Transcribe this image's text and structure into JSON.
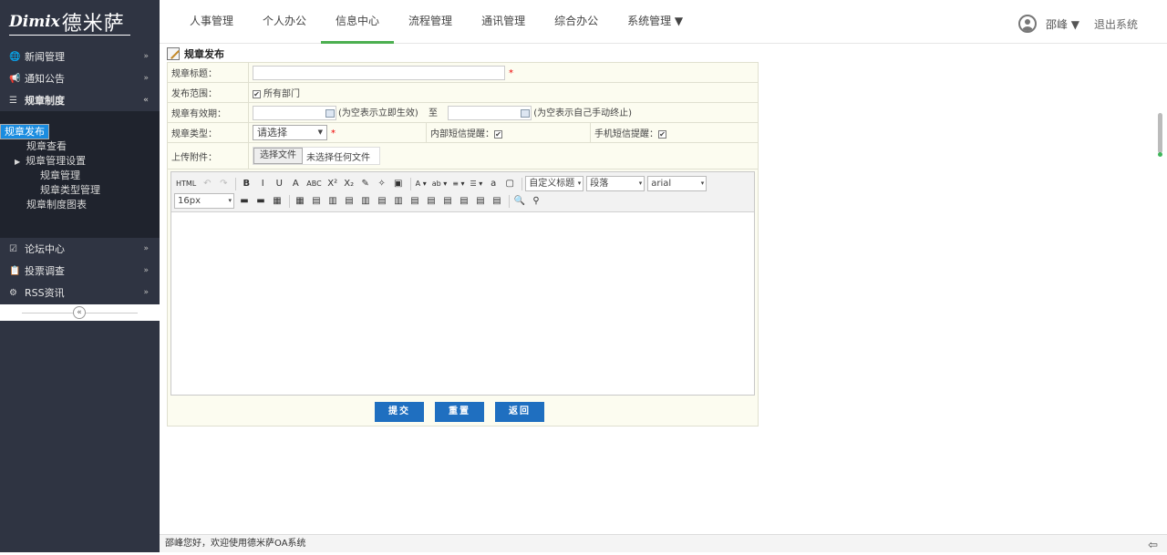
{
  "logo": {
    "en": "Dimix",
    "cn": "德米萨"
  },
  "sidebar": {
    "menus_top": [
      {
        "icon": "globe-icon",
        "glyph": "🌐",
        "label": "新闻管理",
        "arrow": "»"
      },
      {
        "icon": "megaphone-icon",
        "glyph": "📢",
        "label": "通知公告",
        "arrow": "»"
      },
      {
        "icon": "list-icon",
        "glyph": "☰",
        "label": "规章制度",
        "arrow": "«"
      }
    ],
    "sub_items": [
      {
        "label": "规章发布",
        "kind": "sel"
      },
      {
        "label": "规章查看",
        "kind": ""
      },
      {
        "label": "规章管理设置",
        "kind": "grp"
      },
      {
        "label": "规章管理",
        "kind": "l2"
      },
      {
        "label": "规章类型管理",
        "kind": "l2"
      },
      {
        "label": "规章制度图表",
        "kind": ""
      }
    ],
    "menus_bottom": [
      {
        "icon": "forum-icon",
        "glyph": "☑",
        "label": "论坛中心",
        "arrow": "»"
      },
      {
        "icon": "vote-icon",
        "glyph": "📋",
        "label": "投票调查",
        "arrow": "»"
      },
      {
        "icon": "rss-icon",
        "glyph": "⚙",
        "label": "RSS资讯",
        "arrow": "»"
      }
    ],
    "collapse_glyph": "«"
  },
  "topnav": {
    "items": [
      "人事管理",
      "个人办公",
      "信息中心",
      "流程管理",
      "通讯管理",
      "综合办公",
      "系统管理 ▼"
    ],
    "active_index": 2
  },
  "user": {
    "name": "邵峰 ▼",
    "logout": "退出系统"
  },
  "page": {
    "title": "规章发布"
  },
  "form": {
    "title_label": "规章标题：",
    "required_mark": "*",
    "scope_label": "发布范围：",
    "scope_check": "✔",
    "scope_option": "所有部门",
    "valid_label": "规章有效期：",
    "valid_hint1": "(为空表示立即生效)",
    "valid_to": "至",
    "valid_hint2": "(为空表示自己手动终止)",
    "type_label": "规章类型：",
    "type_value": "请选择",
    "type_arrow": "▼",
    "inner_sms_label": "内部短信提醒：",
    "inner_sms_check": "✔",
    "mobile_sms_label": "手机短信提醒：",
    "mobile_sms_check": "✔",
    "attach_label": "上传附件：",
    "attach_button": "选择文件",
    "attach_status": "未选择任何文件"
  },
  "editor": {
    "row1": [
      "HTML",
      "↶",
      "↷",
      "|",
      "B",
      "I",
      "U",
      "A",
      "ABC",
      "X²",
      "X₂",
      "✎",
      "✧",
      "▣",
      "|",
      "A ▾",
      "ab ▾",
      "≡ ▾",
      "☰ ▾",
      "a",
      "▢",
      "|"
    ],
    "heading_select": "自定义标题",
    "para_select": "段落",
    "font_select": "arial",
    "size_select": "16px",
    "row2": [
      "▬",
      "▬",
      "▦",
      "|",
      "▦",
      "▤",
      "▥",
      "▤",
      "▥",
      "▤",
      "▥",
      "▤",
      "▤",
      "▤",
      "▤",
      "▤",
      "▤",
      "|",
      "🔍",
      "⚲"
    ],
    "dd": "▾"
  },
  "buttons": {
    "submit": "提交",
    "reset": "重置",
    "back": "返回"
  },
  "status": {
    "text": "邵峰您好，欢迎使用德米萨OA系统",
    "corner_icon": "⇦"
  }
}
